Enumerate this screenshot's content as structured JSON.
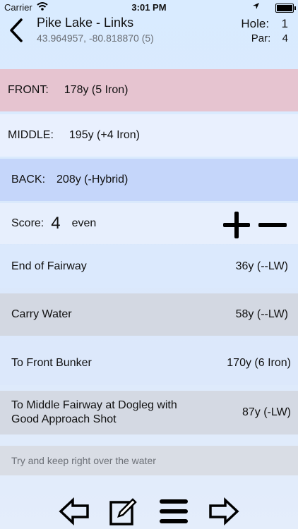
{
  "status": {
    "carrier": "Carrier",
    "time": "3:01 PM"
  },
  "header": {
    "title": "Pike Lake - Links",
    "coords": "43.964957, -80.818870 (5)",
    "hole_label": "Hole:",
    "hole_value": "1",
    "par_label": "Par:",
    "par_value": "4"
  },
  "distances": {
    "front": {
      "label": "FRONT:",
      "value": "178y (5 Iron)"
    },
    "middle": {
      "label": "MIDDLE:",
      "value": "195y (+4 Iron)"
    },
    "back": {
      "label": "BACK:",
      "value": "208y (-Hybrid)"
    }
  },
  "score": {
    "label": "Score:",
    "value": "4",
    "relative": "even"
  },
  "targets": [
    {
      "name": "End of Fairway",
      "distance": "36y (--LW)"
    },
    {
      "name": "Carry Water",
      "distance": "58y (--LW)"
    },
    {
      "name": "To Front Bunker",
      "distance": "170y (6 Iron)"
    },
    {
      "name": "To Middle Fairway at Dogleg with Good Approach Shot",
      "distance": "87y (-LW)"
    }
  ],
  "note": "Try and keep right over the water",
  "icons": {
    "back": "chevron-left-icon",
    "increment": "plus-icon",
    "decrement": "minus-icon",
    "prev": "arrow-left-icon",
    "edit": "edit-icon",
    "menu": "menu-icon",
    "next": "arrow-right-icon"
  }
}
